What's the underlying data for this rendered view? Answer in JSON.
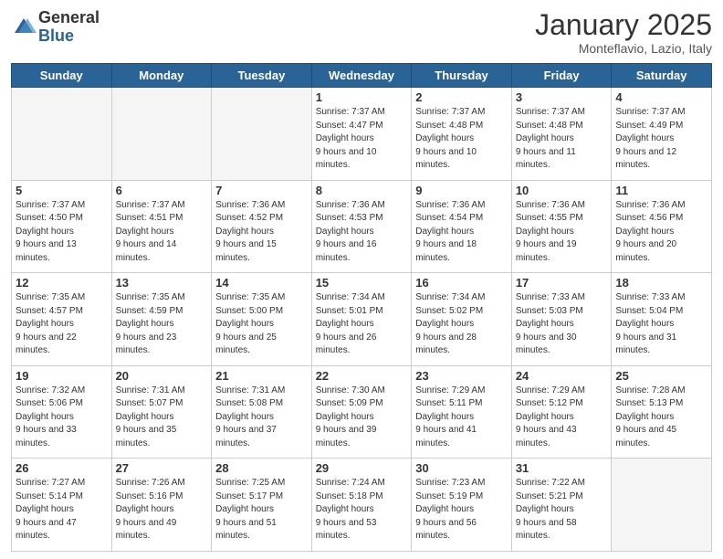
{
  "header": {
    "logo_general": "General",
    "logo_blue": "Blue",
    "month": "January 2025",
    "location": "Monteflavio, Lazio, Italy"
  },
  "days_of_week": [
    "Sunday",
    "Monday",
    "Tuesday",
    "Wednesday",
    "Thursday",
    "Friday",
    "Saturday"
  ],
  "weeks": [
    [
      {
        "day": "",
        "empty": true
      },
      {
        "day": "",
        "empty": true
      },
      {
        "day": "",
        "empty": true
      },
      {
        "day": "1",
        "sunrise": "7:37 AM",
        "sunset": "4:47 PM",
        "daylight": "9 hours and 10 minutes."
      },
      {
        "day": "2",
        "sunrise": "7:37 AM",
        "sunset": "4:48 PM",
        "daylight": "9 hours and 10 minutes."
      },
      {
        "day": "3",
        "sunrise": "7:37 AM",
        "sunset": "4:48 PM",
        "daylight": "9 hours and 11 minutes."
      },
      {
        "day": "4",
        "sunrise": "7:37 AM",
        "sunset": "4:49 PM",
        "daylight": "9 hours and 12 minutes."
      }
    ],
    [
      {
        "day": "5",
        "sunrise": "7:37 AM",
        "sunset": "4:50 PM",
        "daylight": "9 hours and 13 minutes."
      },
      {
        "day": "6",
        "sunrise": "7:37 AM",
        "sunset": "4:51 PM",
        "daylight": "9 hours and 14 minutes."
      },
      {
        "day": "7",
        "sunrise": "7:36 AM",
        "sunset": "4:52 PM",
        "daylight": "9 hours and 15 minutes."
      },
      {
        "day": "8",
        "sunrise": "7:36 AM",
        "sunset": "4:53 PM",
        "daylight": "9 hours and 16 minutes."
      },
      {
        "day": "9",
        "sunrise": "7:36 AM",
        "sunset": "4:54 PM",
        "daylight": "9 hours and 18 minutes."
      },
      {
        "day": "10",
        "sunrise": "7:36 AM",
        "sunset": "4:55 PM",
        "daylight": "9 hours and 19 minutes."
      },
      {
        "day": "11",
        "sunrise": "7:36 AM",
        "sunset": "4:56 PM",
        "daylight": "9 hours and 20 minutes."
      }
    ],
    [
      {
        "day": "12",
        "sunrise": "7:35 AM",
        "sunset": "4:57 PM",
        "daylight": "9 hours and 22 minutes."
      },
      {
        "day": "13",
        "sunrise": "7:35 AM",
        "sunset": "4:59 PM",
        "daylight": "9 hours and 23 minutes."
      },
      {
        "day": "14",
        "sunrise": "7:35 AM",
        "sunset": "5:00 PM",
        "daylight": "9 hours and 25 minutes."
      },
      {
        "day": "15",
        "sunrise": "7:34 AM",
        "sunset": "5:01 PM",
        "daylight": "9 hours and 26 minutes."
      },
      {
        "day": "16",
        "sunrise": "7:34 AM",
        "sunset": "5:02 PM",
        "daylight": "9 hours and 28 minutes."
      },
      {
        "day": "17",
        "sunrise": "7:33 AM",
        "sunset": "5:03 PM",
        "daylight": "9 hours and 30 minutes."
      },
      {
        "day": "18",
        "sunrise": "7:33 AM",
        "sunset": "5:04 PM",
        "daylight": "9 hours and 31 minutes."
      }
    ],
    [
      {
        "day": "19",
        "sunrise": "7:32 AM",
        "sunset": "5:06 PM",
        "daylight": "9 hours and 33 minutes."
      },
      {
        "day": "20",
        "sunrise": "7:31 AM",
        "sunset": "5:07 PM",
        "daylight": "9 hours and 35 minutes."
      },
      {
        "day": "21",
        "sunrise": "7:31 AM",
        "sunset": "5:08 PM",
        "daylight": "9 hours and 37 minutes."
      },
      {
        "day": "22",
        "sunrise": "7:30 AM",
        "sunset": "5:09 PM",
        "daylight": "9 hours and 39 minutes."
      },
      {
        "day": "23",
        "sunrise": "7:29 AM",
        "sunset": "5:11 PM",
        "daylight": "9 hours and 41 minutes."
      },
      {
        "day": "24",
        "sunrise": "7:29 AM",
        "sunset": "5:12 PM",
        "daylight": "9 hours and 43 minutes."
      },
      {
        "day": "25",
        "sunrise": "7:28 AM",
        "sunset": "5:13 PM",
        "daylight": "9 hours and 45 minutes."
      }
    ],
    [
      {
        "day": "26",
        "sunrise": "7:27 AM",
        "sunset": "5:14 PM",
        "daylight": "9 hours and 47 minutes."
      },
      {
        "day": "27",
        "sunrise": "7:26 AM",
        "sunset": "5:16 PM",
        "daylight": "9 hours and 49 minutes."
      },
      {
        "day": "28",
        "sunrise": "7:25 AM",
        "sunset": "5:17 PM",
        "daylight": "9 hours and 51 minutes."
      },
      {
        "day": "29",
        "sunrise": "7:24 AM",
        "sunset": "5:18 PM",
        "daylight": "9 hours and 53 minutes."
      },
      {
        "day": "30",
        "sunrise": "7:23 AM",
        "sunset": "5:19 PM",
        "daylight": "9 hours and 56 minutes."
      },
      {
        "day": "31",
        "sunrise": "7:22 AM",
        "sunset": "5:21 PM",
        "daylight": "9 hours and 58 minutes."
      },
      {
        "day": "",
        "empty": true
      }
    ]
  ],
  "labels": {
    "sunrise": "Sunrise:",
    "sunset": "Sunset:",
    "daylight": "Daylight hours"
  }
}
